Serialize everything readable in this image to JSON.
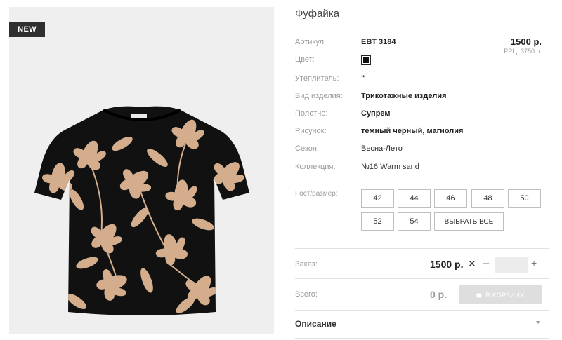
{
  "product": {
    "badge": "NEW",
    "title": "Фуфайка",
    "price": "1500 р.",
    "rrp": "РРЦ: 3750 р."
  },
  "attributes": [
    {
      "label": "Артикул:",
      "value": "EBT 3184"
    },
    {
      "label": "Цвет:",
      "value": ""
    },
    {
      "label": "Утеплитель:",
      "value": "\""
    },
    {
      "label": "Вид изделия:",
      "value": "Трикотажные изделия"
    },
    {
      "label": "Полотно:",
      "value": "Супрем"
    },
    {
      "label": "Рисунок:",
      "value": "темный черный, магнолия"
    },
    {
      "label": "Сезон:",
      "value": "Весна-Лето"
    },
    {
      "label": "Коллекция:",
      "value": "№16 Warm sand"
    }
  ],
  "color_swatch": {
    "hex": "#111111"
  },
  "sizes": {
    "label": "Рост/размер:",
    "options": [
      "42",
      "44",
      "46",
      "48",
      "50",
      "52",
      "54"
    ],
    "select_all": "ВЫБРАТЬ ВСЕ"
  },
  "order": {
    "label": "Заказ:",
    "price": "1500 р.",
    "multiply": "✕",
    "minus": "–",
    "plus": "+",
    "quantity": ""
  },
  "total": {
    "label": "Всего:",
    "value": "0 р.",
    "cart_button": "В КОРЗИНУ"
  },
  "description": {
    "label": "Описание"
  },
  "colors": {
    "garment": "#111111",
    "flower": "#d4ae8c",
    "image_bg": "#efefef",
    "badge_bg": "#2f2f2f",
    "cart_bg": "#dedede"
  }
}
